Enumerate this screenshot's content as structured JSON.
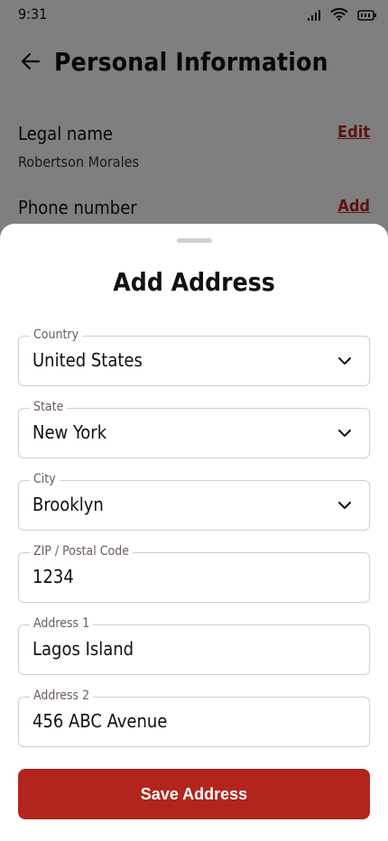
{
  "status_bar": {
    "time": "9:31"
  },
  "header": {
    "title": "Personal Information"
  },
  "info_rows": [
    {
      "label": "Legal name",
      "value": "Robertson Morales",
      "action": "Edit"
    },
    {
      "label": "Phone number",
      "action": "Add"
    }
  ],
  "sheet": {
    "title": "Add Address",
    "fields": [
      {
        "label": "Country",
        "value": "United States",
        "type": "select"
      },
      {
        "label": "State",
        "value": "New York",
        "type": "select"
      },
      {
        "label": "City",
        "value": "Brooklyn",
        "type": "select"
      },
      {
        "label": "ZIP / Postal Code",
        "value": "1234",
        "type": "input"
      },
      {
        "label": "Address 1",
        "value": "Lagos Island",
        "type": "input"
      },
      {
        "label": "Address 2",
        "value": "456 ABC Avenue",
        "type": "input"
      }
    ],
    "save_label": "Save Address"
  },
  "icons": {
    "back": "arrow-left-icon",
    "signal": "signal-icon",
    "wifi": "wifi-icon",
    "battery": "battery-icon",
    "chevron": "chevron-down-icon"
  },
  "colors": {
    "accent": "#b3241c",
    "link": "#c0241d",
    "field_label": "#6b5a6a"
  }
}
